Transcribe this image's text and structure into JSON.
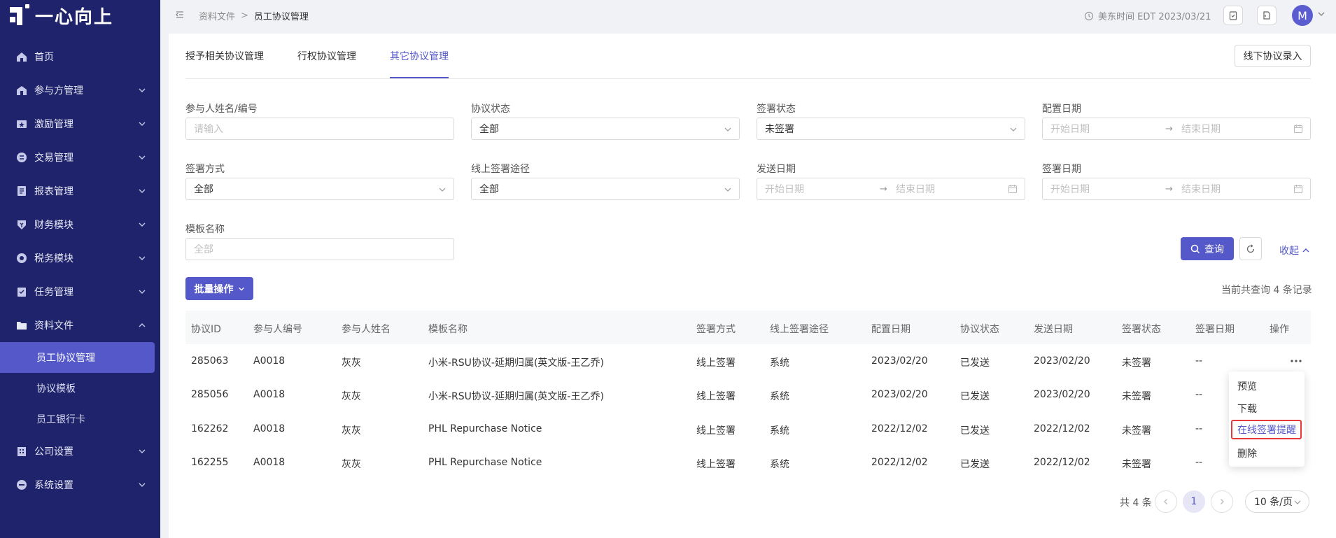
{
  "app": {
    "logo_text": "一心向上"
  },
  "sidebar": {
    "items": [
      {
        "label": "首页",
        "icon": "home-icon",
        "has_children": false
      },
      {
        "label": "参与方管理",
        "icon": "participants-icon",
        "has_children": true
      },
      {
        "label": "激励管理",
        "icon": "incentive-icon",
        "has_children": true
      },
      {
        "label": "交易管理",
        "icon": "trade-icon",
        "has_children": true
      },
      {
        "label": "报表管理",
        "icon": "report-icon",
        "has_children": true
      },
      {
        "label": "财务模块",
        "icon": "finance-icon",
        "has_children": true
      },
      {
        "label": "税务模块",
        "icon": "tax-icon",
        "has_children": true
      },
      {
        "label": "任务管理",
        "icon": "task-icon",
        "has_children": true
      },
      {
        "label": "资料文件",
        "icon": "folder-icon",
        "has_children": true,
        "expanded": true
      }
    ],
    "sub_items": [
      {
        "label": "员工协议管理",
        "active": true
      },
      {
        "label": "协议模板",
        "active": false
      },
      {
        "label": "员工银行卡",
        "active": false
      }
    ],
    "bottom_items": [
      {
        "label": "公司设置",
        "icon": "company-icon"
      },
      {
        "label": "系统设置",
        "icon": "system-icon"
      }
    ]
  },
  "topbar": {
    "breadcrumb_parent": "资料文件",
    "breadcrumb_current": "员工协议管理",
    "timezone": "美东时间 EDT 2023/03/21",
    "avatar_letter": "M"
  },
  "tabs": [
    {
      "label": "授予相关协议管理",
      "active": false
    },
    {
      "label": "行权协议管理",
      "active": false
    },
    {
      "label": "其它协议管理",
      "active": true
    }
  ],
  "offline_button": "线下协议录入",
  "filters": {
    "participant": {
      "label": "参与人姓名/编号",
      "placeholder": "请输入"
    },
    "agreement_status": {
      "label": "协议状态",
      "value": "全部"
    },
    "sign_status": {
      "label": "签署状态",
      "value": "未签署"
    },
    "config_date": {
      "label": "配置日期",
      "start": "开始日期",
      "end": "结束日期"
    },
    "sign_method": {
      "label": "签署方式",
      "value": "全部"
    },
    "online_channel": {
      "label": "线上签署途径",
      "value": "全部"
    },
    "send_date": {
      "label": "发送日期",
      "start": "开始日期",
      "end": "结束日期"
    },
    "sign_date": {
      "label": "签署日期",
      "start": "开始日期",
      "end": "结束日期"
    },
    "template_name": {
      "label": "模板名称",
      "placeholder": "全部"
    },
    "query_button": "查询",
    "collapse_link": "收起"
  },
  "batch_button": "批量操作",
  "total_text": "当前共查询 4 条记录",
  "table": {
    "headers": [
      "协议ID",
      "参与人编号",
      "参与人姓名",
      "模板名称",
      "签署方式",
      "线上签署途径",
      "配置日期",
      "协议状态",
      "发送日期",
      "签署状态",
      "签署日期",
      "操作"
    ],
    "rows": [
      [
        "285063",
        "A0018",
        "灰灰",
        "小米-RSU协议-延期归属(英文版-王乙乔)",
        "线上签署",
        "系统",
        "2023/02/20",
        "已发送",
        "2023/02/20",
        "未签署",
        "--"
      ],
      [
        "285056",
        "A0018",
        "灰灰",
        "小米-RSU协议-延期归属(英文版-王乙乔)",
        "线上签署",
        "系统",
        "2023/02/20",
        "已发送",
        "2023/02/20",
        "未签署",
        "--"
      ],
      [
        "162262",
        "A0018",
        "灰灰",
        "PHL Repurchase Notice",
        "线上签署",
        "系统",
        "2022/12/02",
        "已发送",
        "2022/12/02",
        "未签署",
        "--"
      ],
      [
        "162255",
        "A0018",
        "灰灰",
        "PHL Repurchase Notice",
        "线上签署",
        "系统",
        "2022/12/02",
        "已发送",
        "2022/12/02",
        "未签署",
        "--"
      ]
    ]
  },
  "row_menu": {
    "items": [
      "预览",
      "下载",
      "在线签署提醒",
      "删除"
    ],
    "highlighted": "在线签署提醒"
  },
  "pagination": {
    "total": "共 4 条",
    "current_page": "1",
    "page_size": "10 条/页"
  },
  "colors": {
    "sidebar_bg": "#1f236b",
    "accent": "#5558c9",
    "highlight_border": "#e63a3a"
  }
}
